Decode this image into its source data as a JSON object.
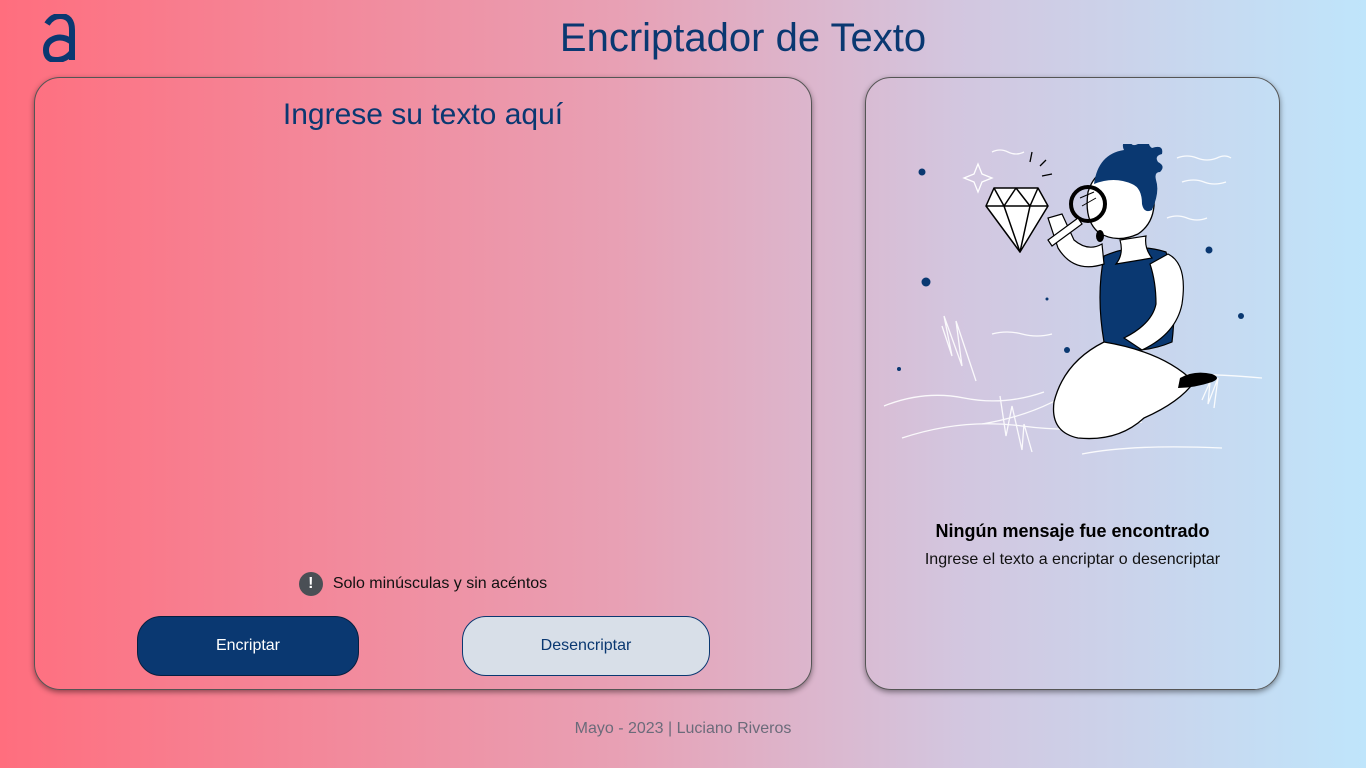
{
  "header": {
    "title": "Encriptador de Texto",
    "logo_icon": "alura-logo-icon"
  },
  "input_panel": {
    "placeholder": "Ingrese su texto aquí",
    "value": "",
    "hint": "Solo minúsculas y sin acéntos",
    "hint_icon": "exclamation-circle-icon",
    "encrypt_label": "Encriptar",
    "decrypt_label": "Desencriptar"
  },
  "output_panel": {
    "illustration": "person-with-magnifier-illustration",
    "title": "Ningún mensaje fue encontrado",
    "subtitle": "Ingrese el texto a encriptar o desencriptar"
  },
  "footer": {
    "text": "Mayo - 2023 | Luciano Riveros"
  },
  "colors": {
    "primary": "#0a3871",
    "secondary_button": "#d8dfe8",
    "gradient_start": "#ff6e7e",
    "gradient_end": "#bfe5fb"
  }
}
